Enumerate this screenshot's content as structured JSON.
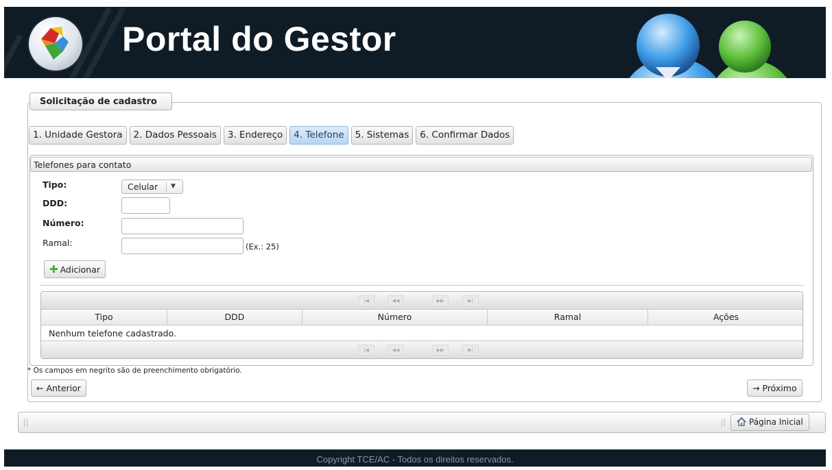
{
  "header": {
    "title": "Portal do Gestor"
  },
  "form": {
    "legend": "Solicitação de cadastro",
    "tabs": [
      {
        "label": "1. Unidade Gestora"
      },
      {
        "label": "2. Dados Pessoais"
      },
      {
        "label": "3. Endereço"
      },
      {
        "label": "4. Telefone",
        "active": true
      },
      {
        "label": "5. Sistemas"
      },
      {
        "label": "6. Confirmar Dados"
      }
    ],
    "panel": {
      "title": "Telefones para contato",
      "fields": {
        "tipo_label": "Tipo:",
        "tipo_value": "Celular",
        "ddd_label": "DDD:",
        "ddd_value": "",
        "numero_label": "Número:",
        "numero_value": "",
        "ramal_label": "Ramal:",
        "ramal_value": "",
        "ramal_hint": "(Ex.: 25)"
      },
      "add_button": "Adicionar",
      "table": {
        "columns": [
          "Tipo",
          "DDD",
          "Número",
          "Ramal",
          "Ações"
        ],
        "empty_message": "Nenhum telefone cadastrado.",
        "pager_icons": [
          "first-page-icon",
          "previous-page-icon",
          "next-page-icon",
          "last-page-icon"
        ]
      }
    },
    "required_note": "* Os campos em negrito são de preenchimento obrigatório.",
    "prev_button": "← Anterior",
    "next_button": "→ Próximo"
  },
  "toolbar": {
    "home_button": "Página Inicial",
    "home_icon": "home-icon"
  },
  "footer": {
    "copyright": "Copyright TCE/AC - Todos os direitos reservados."
  },
  "colors": {
    "banner": "#0f1c26",
    "active_tab": "#b9d5f1",
    "add_icon": "#49a835"
  }
}
